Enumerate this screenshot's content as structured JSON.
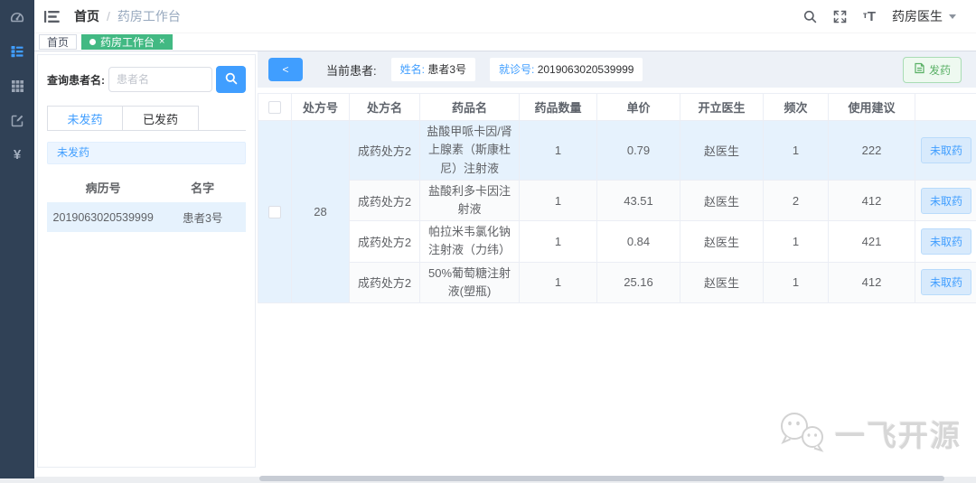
{
  "sidebar": {
    "icons": [
      "dashboard-icon",
      "menu-list-icon",
      "table-icon",
      "form-edit-icon",
      "money-yen-icon"
    ],
    "active_index": 1,
    "bg": "#304156",
    "active_color": "#409eff"
  },
  "navbar": {
    "breadcrumb": {
      "home": "首页",
      "separator": "/",
      "current": "药房工作台"
    },
    "icons": [
      "search-icon",
      "fullscreen-icon",
      "font-size-icon"
    ],
    "font_size_icon_text_small": "т",
    "font_size_icon_text_big": "T",
    "user_name": "药房医生"
  },
  "tags_bar": {
    "tabs": [
      {
        "label": "首页",
        "active": false
      },
      {
        "label": "药房工作台",
        "active": true,
        "close": "×"
      }
    ],
    "active_color": "#42b983"
  },
  "left_panel": {
    "search_label": "查询患者名:",
    "search_placeholder": "患者名",
    "tabs": [
      {
        "label": "未发药",
        "active": true
      },
      {
        "label": "已发药",
        "active": false
      }
    ],
    "banner_text": "未发药",
    "patient_table": {
      "headers": {
        "record_no": "病历号",
        "name": "名字"
      },
      "rows": [
        {
          "record_no": "2019063020539999",
          "name": "患者3号"
        }
      ]
    }
  },
  "patient_bar": {
    "collapse_label": "<",
    "current_patient_label": "当前患者:",
    "name_label": "姓名:",
    "name_value": "患者3号",
    "visit_label": "就诊号:",
    "visit_value": "2019063020539999",
    "dispense_button": "发药"
  },
  "prescription_table": {
    "headers": {
      "prescription_no": "处方号",
      "prescription_name": "处方名",
      "drug_name": "药品名",
      "drug_qty": "药品数量",
      "unit_price": "单价",
      "doctor": "开立医生",
      "frequency": "频次",
      "advice": "使用建议"
    },
    "group_prescription_no": "28",
    "rows": [
      {
        "prescription_name": "成药处方2",
        "drug_name": "盐酸甲哌卡因/肾上腺素（斯康杜尼）注射液",
        "qty": "1",
        "price": "0.79",
        "doctor": "赵医生",
        "frequency": "1",
        "advice": "222",
        "status": "未取药"
      },
      {
        "prescription_name": "成药处方2",
        "drug_name": "盐酸利多卡因注射液",
        "qty": "1",
        "price": "43.51",
        "doctor": "赵医生",
        "frequency": "2",
        "advice": "412",
        "status": "未取药"
      },
      {
        "prescription_name": "成药处方2",
        "drug_name": "帕拉米韦氯化钠注射液（力纬）",
        "qty": "1",
        "price": "0.84",
        "doctor": "赵医生",
        "frequency": "1",
        "advice": "421",
        "status": "未取药"
      },
      {
        "prescription_name": "成药处方2",
        "drug_name": "50%葡萄糖注射液(塑瓶)",
        "qty": "1",
        "price": "25.16",
        "doctor": "赵医生",
        "frequency": "1",
        "advice": "412",
        "status": "未取药"
      }
    ]
  },
  "watermark": {
    "text": "一飞开源"
  },
  "colors": {
    "sidebar_bg": "#304156",
    "primary_blue": "#409eff",
    "tag_active_green": "#42b983",
    "dispense_green": "#59b065",
    "row_highlight": "#e6f2fd",
    "strip_bg": "#edf1f7"
  }
}
